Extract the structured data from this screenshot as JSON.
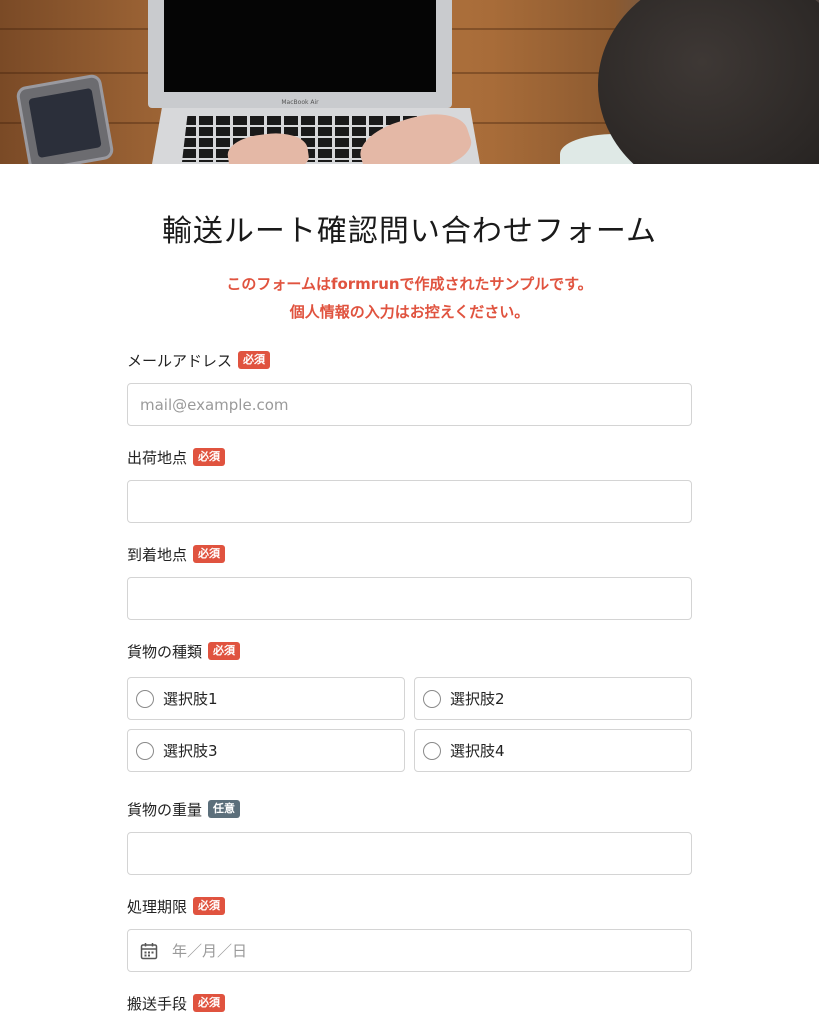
{
  "form": {
    "title": "輸送ルート確認問い合わせフォーム",
    "notice_line1": "このフォームはformrunで作成されたサンプルです。",
    "notice_line2": "個人情報の入力はお控えください。"
  },
  "hero": {
    "laptop_brand": "MacBook Air"
  },
  "badges": {
    "required": "必須",
    "optional": "任意"
  },
  "fields": {
    "email": {
      "label": "メールアドレス",
      "placeholder": "mail@example.com",
      "value": ""
    },
    "origin": {
      "label": "出荷地点",
      "value": ""
    },
    "destination": {
      "label": "到着地点",
      "value": ""
    },
    "cargo_type": {
      "label": "貨物の種類",
      "options": [
        "選択肢1",
        "選択肢2",
        "選択肢3",
        "選択肢4"
      ]
    },
    "cargo_weight": {
      "label": "貨物の重量",
      "value": ""
    },
    "deadline": {
      "label": "処理期限",
      "placeholder": "年／月／日",
      "icon": "calendar-icon"
    },
    "transport_method": {
      "label": "搬送手段"
    }
  },
  "colors": {
    "accent": "#e0533f",
    "required_badge": "#e0533f",
    "optional_badge": "#5c6f7b",
    "border": "#d4d4d4"
  }
}
